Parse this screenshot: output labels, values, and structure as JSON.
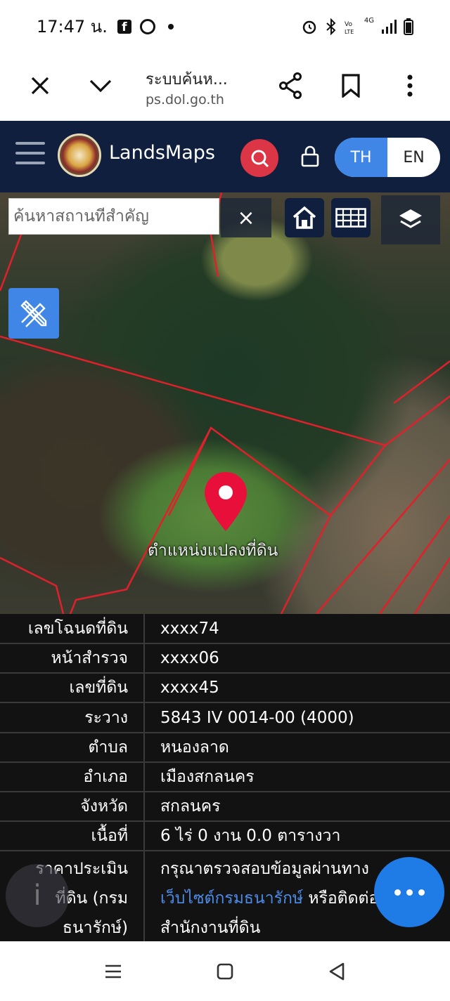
{
  "status_bar": {
    "time": "17:47 น.",
    "signal_label": "4G"
  },
  "browser": {
    "page_title": "ระบบค้นห...",
    "url_host": "ps.dol.go.th"
  },
  "app": {
    "brand": "LandsMaps",
    "lang_th": "TH",
    "lang_en": "EN",
    "search_placeholder": "ค้นหาสถานที่สำคัญ",
    "clear_symbol": "×",
    "pin_label": "ตำแหน่งแปลงที่ดิน"
  },
  "parcel_table": {
    "rows": [
      {
        "label": "เลขโฉนดที่ดิน",
        "value": "xxxx74"
      },
      {
        "label": "หน้าสำรวจ",
        "value": "xxxx06"
      },
      {
        "label": "เลขที่ดิน",
        "value": "xxxx45"
      },
      {
        "label": "ระวาง",
        "value": "5843 IV 0014-00 (4000)"
      },
      {
        "label": "ตำบล",
        "value": "หนองลาด"
      },
      {
        "label": "อำเภอ",
        "value": "เมืองสกลนคร"
      },
      {
        "label": "จังหวัด",
        "value": "สกลนคร"
      },
      {
        "label": "เนื้อที่",
        "value": "6 ไร่ 0 งาน 0.0 ตารางวา"
      }
    ],
    "price": {
      "label_line1": "ราคาประเมิน",
      "label_line2": "ที่ดิน (กรม",
      "label_line3": "ธนารักษ์)",
      "value_line1": "กรุณาตรวจสอบข้อมูลผ่านทาง",
      "value_link": "เว็บไซต์กรมธนารักษ์",
      "value_line2_rest": " หรือติดต่อ",
      "value_line3": "สำนักงานที่ดิน"
    }
  },
  "colors": {
    "app_bar": "#0f1f3d",
    "search_red": "#dc3545",
    "accent_blue": "#3f86e6",
    "fab_blue": "#1f7be6",
    "parcel_line": "#e0202a",
    "pin_red": "#e8103a"
  }
}
